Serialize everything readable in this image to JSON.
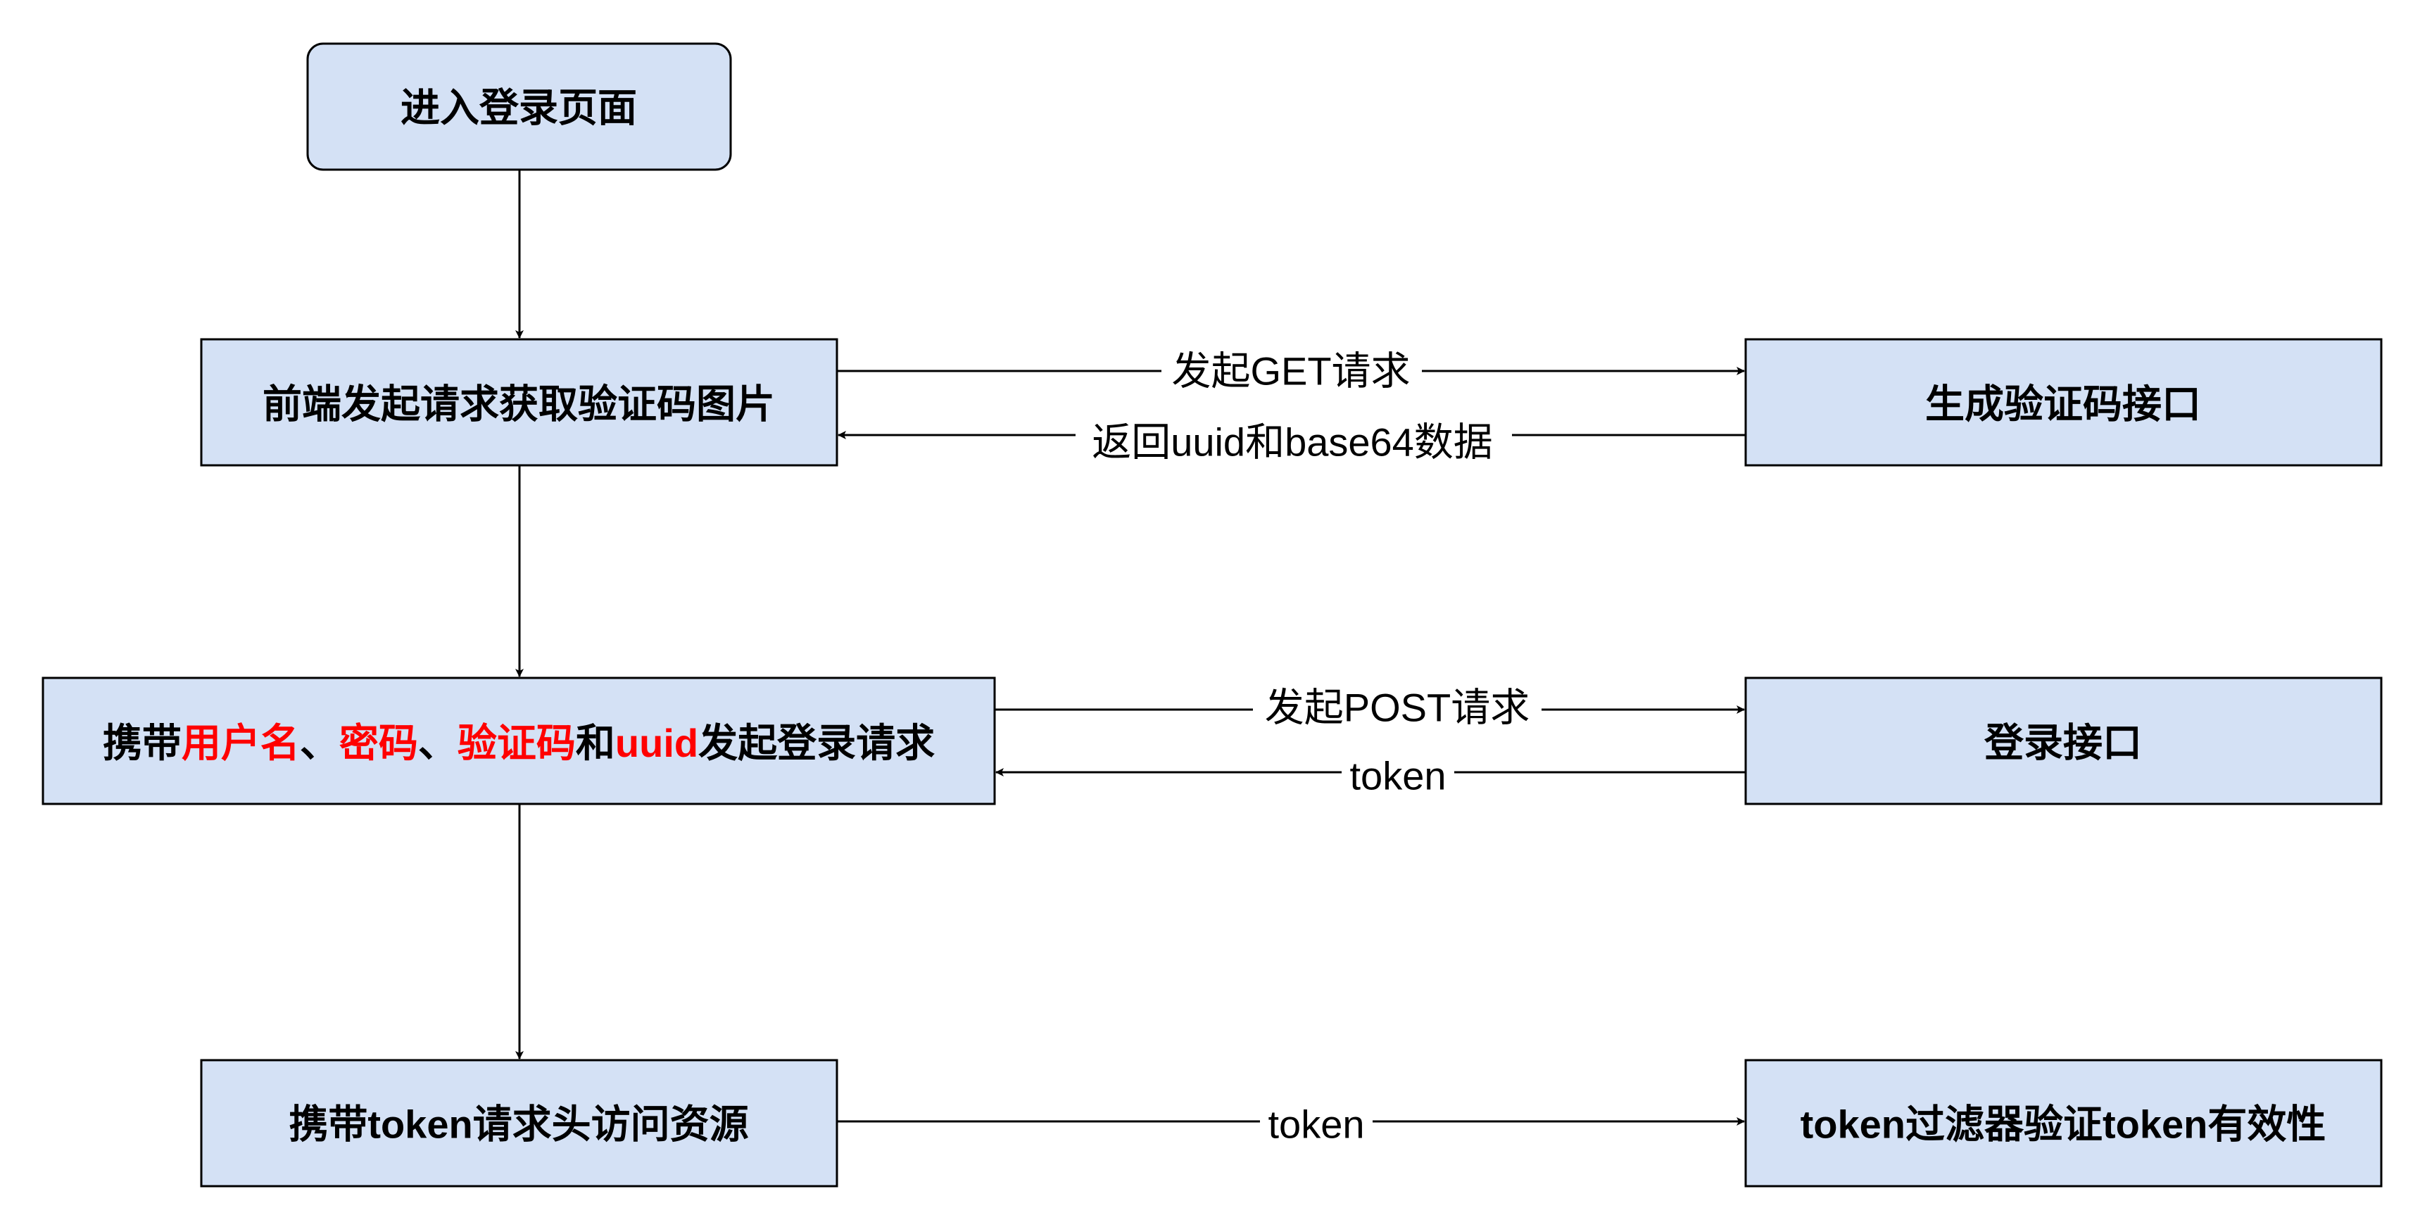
{
  "colors": {
    "node_fill": "#d4e1f5",
    "node_stroke": "#000000",
    "edge_stroke": "#000000",
    "highlight_text": "#ff0000",
    "background": "#ffffff"
  },
  "nodes": {
    "enter_login_page": "进入登录页面",
    "request_captcha": "前端发起请求获取验证码图片",
    "captcha_api": "生成验证码接口",
    "login_request": {
      "prefix": "携带",
      "username": "用户名",
      "sep1": "、",
      "password": "密码",
      "sep2": "、",
      "captcha": "验证码",
      "and": "和",
      "uuid": "uuid",
      "suffix": "发起登录请求"
    },
    "login_api": "登录接口",
    "access_resource": "携带token请求头访问资源",
    "token_filter": "token过滤器验证token有效性"
  },
  "edges": {
    "get_request": "发起GET请求",
    "return_uuid_base64": "返回uuid和base64数据",
    "post_request": "发起POST请求",
    "token_return": "token",
    "token_send": "token"
  }
}
